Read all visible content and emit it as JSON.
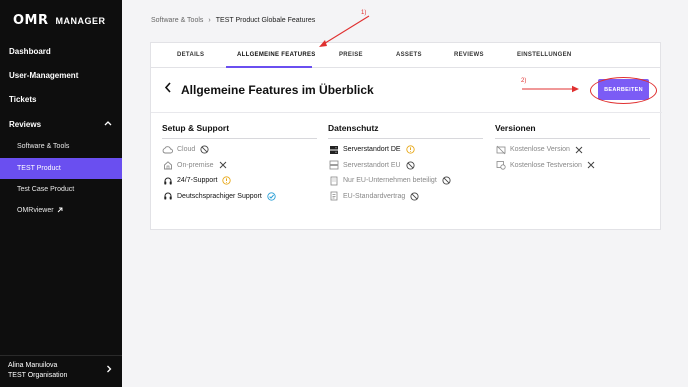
{
  "app": {
    "logo_mark": "OMR",
    "logo_text": "MANAGER"
  },
  "sidebar": {
    "items": [
      {
        "label": "Dashboard"
      },
      {
        "label": "User-Management"
      },
      {
        "label": "Tickets"
      },
      {
        "label": "Reviews"
      }
    ],
    "sub_items": [
      {
        "label": "Software & Tools"
      },
      {
        "label": "TEST Product"
      },
      {
        "label": "Test Case Product"
      },
      {
        "label": "OMRviewer"
      }
    ],
    "user_name": "Alina Manuilova",
    "organisation": "TEST Organisation"
  },
  "breadcrumb": {
    "parent": "Software & Tools",
    "separator": "›",
    "current": "TEST Product Globale Features"
  },
  "tabs": [
    {
      "label": "DETAILS"
    },
    {
      "label": "ALLGEMEINE FEATURES"
    },
    {
      "label": "PREISE"
    },
    {
      "label": "ASSETS"
    },
    {
      "label": "REVIEWS"
    },
    {
      "label": "EINSTELLUNGEN"
    }
  ],
  "panel": {
    "title": "Allgemeine Features im Überblick",
    "edit_label": "BEARBEITEN"
  },
  "sections": [
    {
      "title": "Setup & Support",
      "features": [
        {
          "label": "Cloud",
          "icon": "cloud-icon",
          "status": "not-available"
        },
        {
          "label": "On-premise",
          "icon": "house-icon",
          "status": "no"
        },
        {
          "label": "24/7-Support",
          "icon": "headset-icon",
          "status": "info"
        },
        {
          "label": "Deutschsprachiger Support",
          "icon": "headset-icon",
          "status": "yes"
        }
      ]
    },
    {
      "title": "Datenschutz",
      "features": [
        {
          "label": "Serverstandort DE",
          "icon": "server-icon",
          "status": "info"
        },
        {
          "label": "Serverstandort EU",
          "icon": "server-icon",
          "status": "not-available"
        },
        {
          "label": "Nur EU-Unternehmen beteiligt",
          "icon": "building-icon",
          "status": "not-available"
        },
        {
          "label": "EU-Standardvertrag",
          "icon": "document-icon",
          "status": "not-available"
        }
      ]
    },
    {
      "title": "Versionen",
      "features": [
        {
          "label": "Kostenlose Version",
          "icon": "price-tag-icon",
          "status": "no"
        },
        {
          "label": "Kostenlose Testversion",
          "icon": "trial-icon",
          "status": "no"
        }
      ]
    }
  ],
  "annotations": {
    "one": "1)",
    "two": "2)"
  },
  "colors": {
    "accent": "#7b5cf5",
    "sidebar_bg": "#0e0e0e",
    "active_item": "#6a4ff0",
    "warning": "#e8a91a",
    "check": "#2a9fd6",
    "annotation": "#e03030"
  }
}
